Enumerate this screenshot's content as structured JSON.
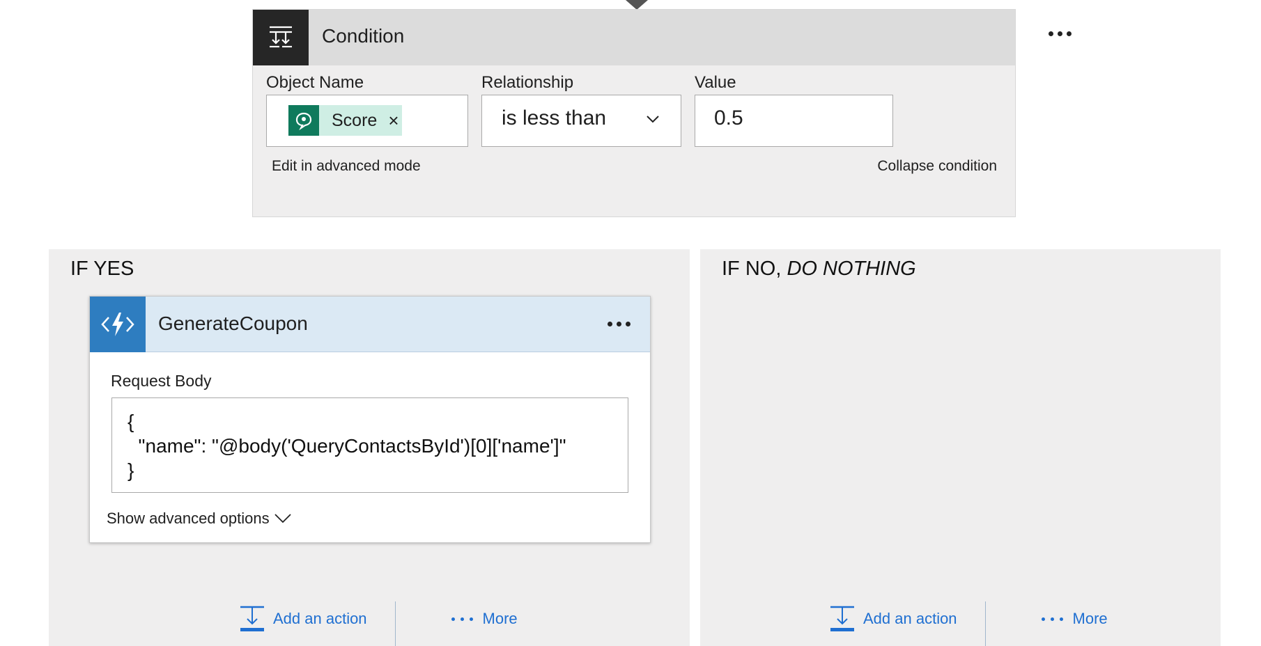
{
  "condition": {
    "title": "Condition",
    "icon": "condition-icon",
    "object_name_label": "Object Name",
    "object_token": {
      "text": "Score",
      "icon": "sentiment-icon",
      "remove": "×"
    },
    "relationship_label": "Relationship",
    "relationship_value": "is less than",
    "value_label": "Value",
    "value": "0.5",
    "edit_advanced": "Edit in advanced mode",
    "collapse": "Collapse condition"
  },
  "if_yes": {
    "title": "IF YES",
    "action": {
      "title": "GenerateCoupon",
      "icon": "function-icon",
      "body_label": "Request Body",
      "body": "{\n  \"name\": \"@body('QueryContactsById')[0]['name']\"\n}",
      "show_advanced": "Show advanced options"
    },
    "add_action": "Add an action",
    "more": "More"
  },
  "if_no": {
    "title_prefix": "IF NO,",
    "title_suffix": "DO NOTHING",
    "add_action": "Add an action",
    "more": "More"
  },
  "colors": {
    "accent": "#1f6fd1",
    "condition_icon_bg": "#262626",
    "action_icon_bg": "#2e7dc0",
    "token_bg": "#cfeee4",
    "token_icon_bg": "#0f7a5c"
  }
}
